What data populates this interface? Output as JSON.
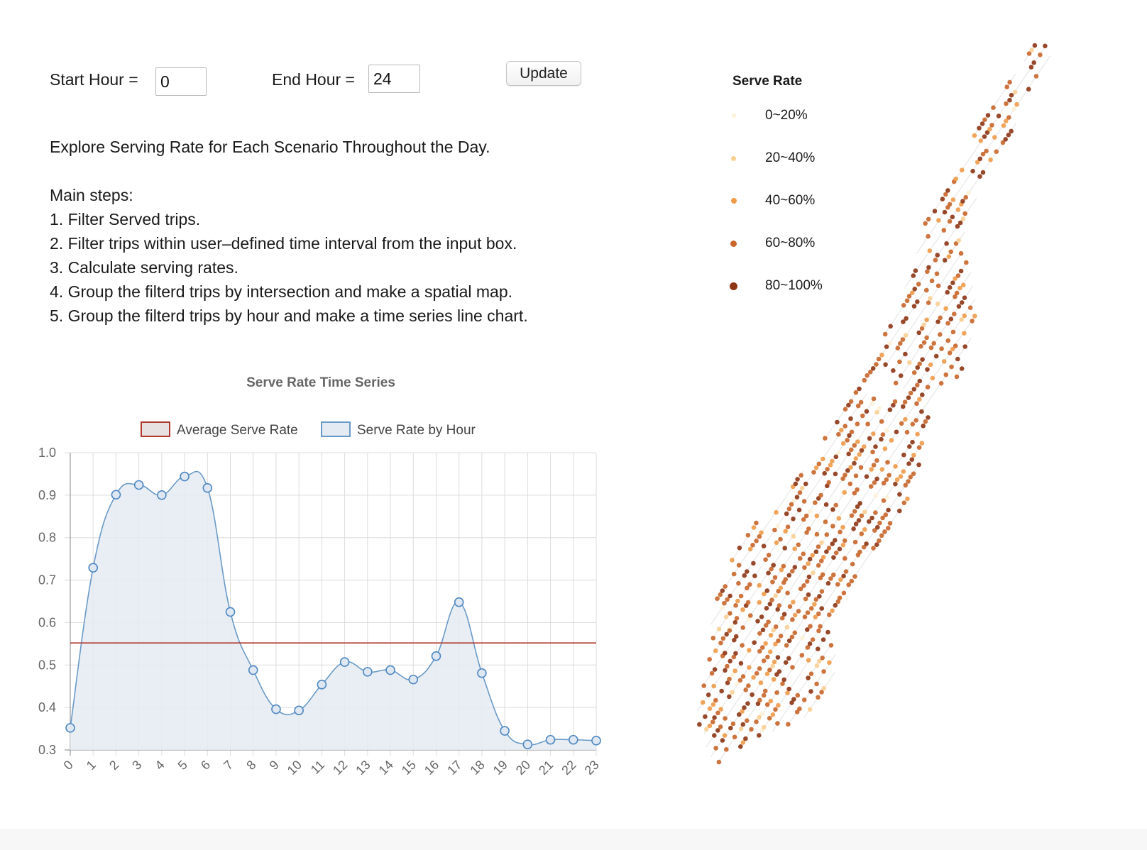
{
  "controls": {
    "start_label": "Start Hour =",
    "start_value": "0",
    "end_label": "End Hour =",
    "end_value": "24",
    "update_label": "Update"
  },
  "intro": {
    "headline": "Explore Serving Rate for Each Scenario Throughout the Day.",
    "steps_title": "Main steps:",
    "steps": [
      "1. Filter Served trips.",
      "2. Filter trips within user–defined time interval from the input box.",
      "3. Calculate serving rates.",
      "4. Group the filterd trips by intersection and make a spatial map.",
      "5. Group the filterd trips by hour and make a time series line chart."
    ]
  },
  "chart_data": {
    "type": "line",
    "title": "Serve Rate Time Series",
    "categories": [
      "0",
      "1",
      "2",
      "3",
      "4",
      "5",
      "6",
      "7",
      "8",
      "9",
      "10",
      "11",
      "12",
      "13",
      "14",
      "15",
      "16",
      "17",
      "18",
      "19",
      "20",
      "21",
      "22",
      "23"
    ],
    "series": [
      {
        "name": "Average Serve Rate",
        "values": [
          0.552,
          0.552,
          0.552,
          0.552,
          0.552,
          0.552,
          0.552,
          0.552,
          0.552,
          0.552,
          0.552,
          0.552,
          0.552,
          0.552,
          0.552,
          0.552,
          0.552,
          0.552,
          0.552,
          0.552,
          0.552,
          0.552,
          0.552,
          0.552
        ],
        "color": "#b03a2e",
        "fill": "#e8e1e1"
      },
      {
        "name": "Serve Rate by Hour",
        "values": [
          0.352,
          0.729,
          0.901,
          0.924,
          0.9,
          0.944,
          0.917,
          0.625,
          0.488,
          0.396,
          0.393,
          0.454,
          0.507,
          0.484,
          0.488,
          0.466,
          0.521,
          0.648,
          0.481,
          0.345,
          0.313,
          0.324,
          0.324,
          0.322
        ],
        "color": "#6a9ac7",
        "fill": "#e4ebf2"
      }
    ],
    "ylim": [
      0.3,
      1.0
    ],
    "yticks": [
      "0.3",
      "0.4",
      "0.5",
      "0.6",
      "0.7",
      "0.8",
      "0.9",
      "1.0"
    ],
    "grid": true,
    "legend_position": "top"
  },
  "map": {
    "legend_title": "Serve Rate",
    "classes": [
      {
        "label": "0~20%",
        "color": "#fdf1d8"
      },
      {
        "label": "20~40%",
        "color": "#f9cf93"
      },
      {
        "label": "40~60%",
        "color": "#ef9b4a"
      },
      {
        "label": "60~80%",
        "color": "#c9652a"
      },
      {
        "label": "80~100%",
        "color": "#8e3514"
      }
    ]
  }
}
